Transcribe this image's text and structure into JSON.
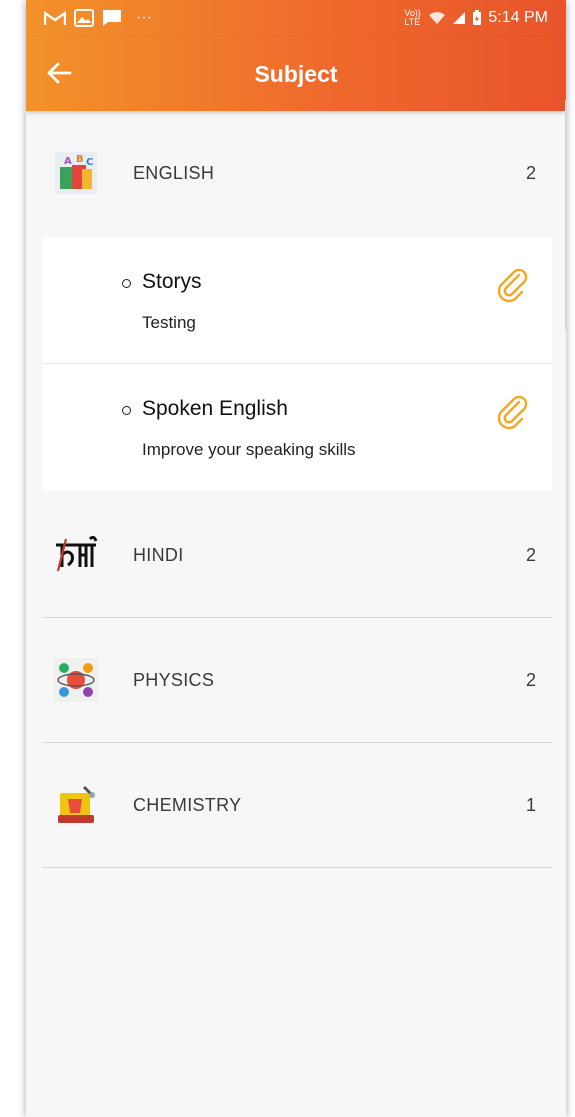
{
  "status_bar": {
    "left_icons": [
      "gmail-icon",
      "gallery-icon",
      "message-icon"
    ],
    "more": "···",
    "volte": "Vo)) LTE",
    "time": "5:14 PM"
  },
  "app_bar": {
    "title": "Subject"
  },
  "subjects": [
    {
      "name": "ENGLISH",
      "count": "2",
      "icon": "english-books-icon"
    },
    {
      "name": "HINDI",
      "count": "2",
      "icon": "hindi-script-icon"
    },
    {
      "name": "PHYSICS",
      "count": "2",
      "icon": "physics-icon"
    },
    {
      "name": "CHEMISTRY",
      "count": "1",
      "icon": "chemistry-icon"
    }
  ],
  "english_topics": [
    {
      "title": "Storys",
      "description": "Testing",
      "icon": "paperclip-icon"
    },
    {
      "title": "Spoken English",
      "description": "Improve your speaking skills",
      "icon": "paperclip-icon"
    }
  ],
  "colors": {
    "header_start": "#f2922a",
    "header_end": "#e8542a",
    "accent_clip": "#f5a623",
    "background": "#f7f7f7"
  }
}
